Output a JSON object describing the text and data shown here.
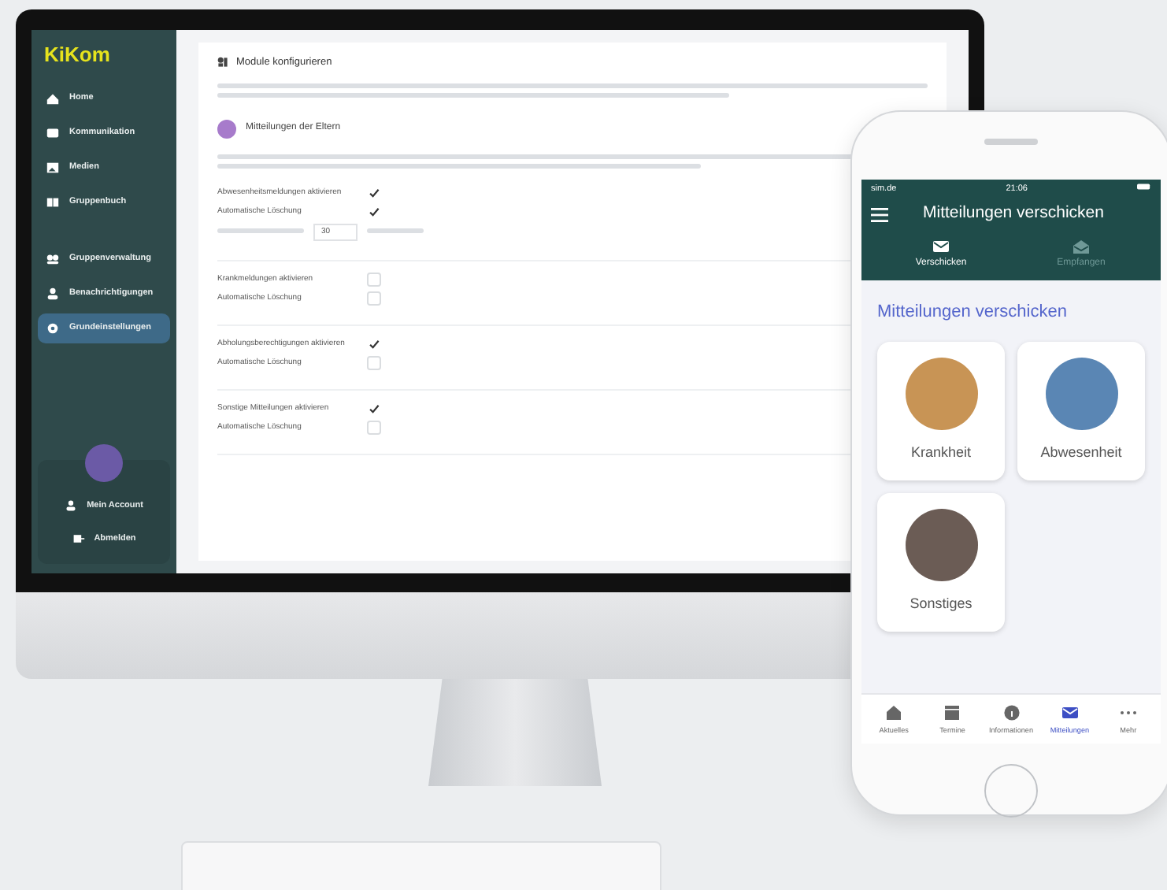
{
  "app": {
    "logo": "KiKom"
  },
  "sidebar": {
    "items": [
      {
        "label": "Home",
        "selected": false
      },
      {
        "label": "Kommunikation",
        "selected": false
      },
      {
        "label": "Medien",
        "selected": false
      },
      {
        "label": "Gruppenbuch",
        "selected": false
      },
      {
        "label": "Gruppenverwaltung",
        "selected": false
      },
      {
        "label": "Benachrichtigungen",
        "selected": false
      },
      {
        "label": "Grundeinstellungen",
        "selected": true
      }
    ],
    "footer_items": [
      {
        "label": "Mein Account"
      },
      {
        "label": "Abmelden"
      }
    ]
  },
  "page": {
    "title": "Module konfigurieren",
    "section_title": "Mitteilungen der Eltern",
    "groups": [
      {
        "settings": [
          {
            "label": "Abwesenheitsmeldungen aktivieren",
            "checked": true
          },
          {
            "label": "Automatische Löschung",
            "checked": true
          }
        ],
        "retention": {
          "value": "30"
        }
      },
      {
        "settings": [
          {
            "label": "Krankmeldungen aktivieren",
            "checked": false
          },
          {
            "label": "Automatische Löschung",
            "checked": false
          }
        ]
      },
      {
        "settings": [
          {
            "label": "Abholungsberechtigungen aktivieren",
            "checked": true
          },
          {
            "label": "Automatische Löschung",
            "checked": false
          }
        ]
      },
      {
        "settings": [
          {
            "label": "Sonstige Mitteilungen aktivieren",
            "checked": true
          },
          {
            "label": "Automatische Löschung",
            "checked": false
          }
        ]
      }
    ]
  },
  "phone": {
    "status": {
      "carrier": "sim.de",
      "time": "21:06"
    },
    "title": "Mitteilungen verschicken",
    "tabs": [
      {
        "label": "Verschicken",
        "selected": true
      },
      {
        "label": "Empfangen",
        "selected": false
      }
    ],
    "heading": "Mitteilungen verschicken",
    "tiles": [
      {
        "label": "Krankheit"
      },
      {
        "label": "Abwesenheit"
      },
      {
        "label": "Sonstiges"
      }
    ],
    "bottom_nav": [
      {
        "label": "Aktuelles",
        "selected": false
      },
      {
        "label": "Termine",
        "selected": false
      },
      {
        "label": "Informationen",
        "selected": false
      },
      {
        "label": "Mitteilungen",
        "selected": true
      },
      {
        "label": "Mehr",
        "selected": false
      }
    ]
  }
}
